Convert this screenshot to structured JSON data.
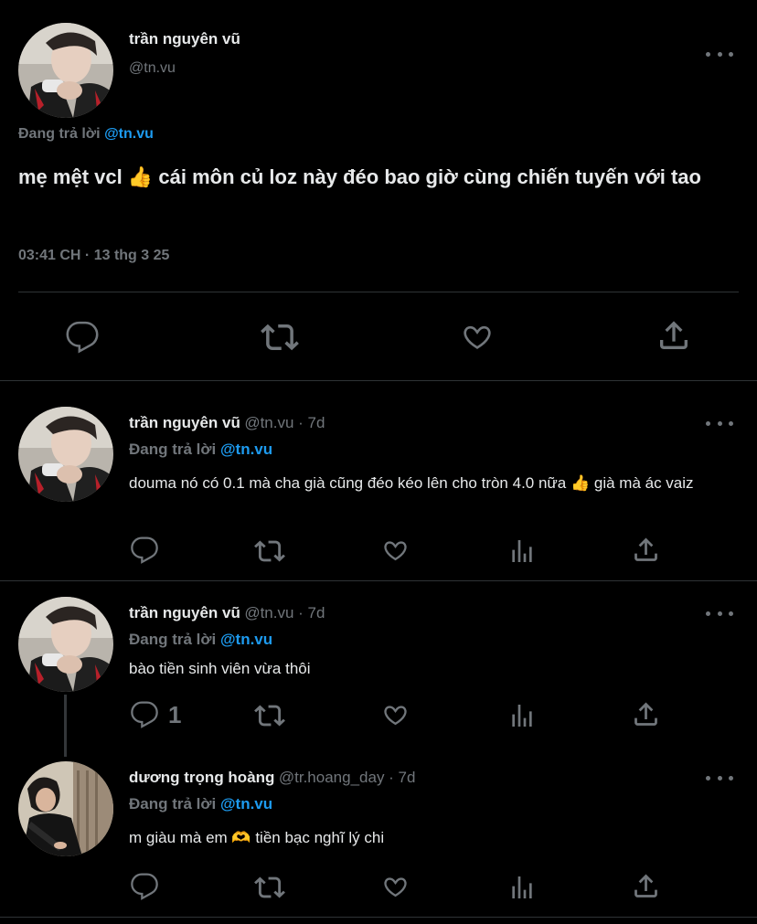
{
  "main_tweet": {
    "author_name": "trần nguyên vũ",
    "author_handle": "@tn.vu",
    "replying_label": "Đang trả lời",
    "replying_to": "@tn.vu",
    "text_part1": "mẹ mệt vcl",
    "text_emoji": "👍",
    "text_part2": " cái môn củ loz này đéo bao giờ cùng chiến tuyến với tao",
    "timestamp": "03:41 CH · 13 thg 3 25"
  },
  "replies": [
    {
      "author_name": "trần nguyên vũ",
      "author_handle": "@tn.vu · 7d",
      "replying_label": "Đang trả lời",
      "replying_to": "@tn.vu",
      "text": "douma nó có 0.1 mà cha già cũng đéo kéo lên cho tròn 4.0 nữa 👍 già mà ác vaiz",
      "reply_count": ""
    },
    {
      "author_name": "trần nguyên vũ",
      "author_handle": "@tn.vu · 7d",
      "replying_label": "Đang trả lời",
      "replying_to": "@tn.vu",
      "text": "bào tiền sinh viên vừa thôi",
      "reply_count": "1"
    },
    {
      "author_name": "dương trọng hoàng",
      "author_handle": "@tr.hoang_day · 7d",
      "replying_label": "Đang trả lời",
      "replying_to": "@tn.vu",
      "text": "m giàu mà em 🫶 tiền bạc nghĩ lý chi",
      "reply_count": ""
    }
  ],
  "icons": {
    "reply": "reply-icon",
    "repost": "repost-icon",
    "like": "like-icon",
    "views": "views-icon",
    "share": "share-icon",
    "more": "more-icon"
  },
  "colors": {
    "background": "#000000",
    "text": "#e7e9ea",
    "muted": "#71767b",
    "accent": "#1d9bf0",
    "divider": "#2f3336"
  }
}
